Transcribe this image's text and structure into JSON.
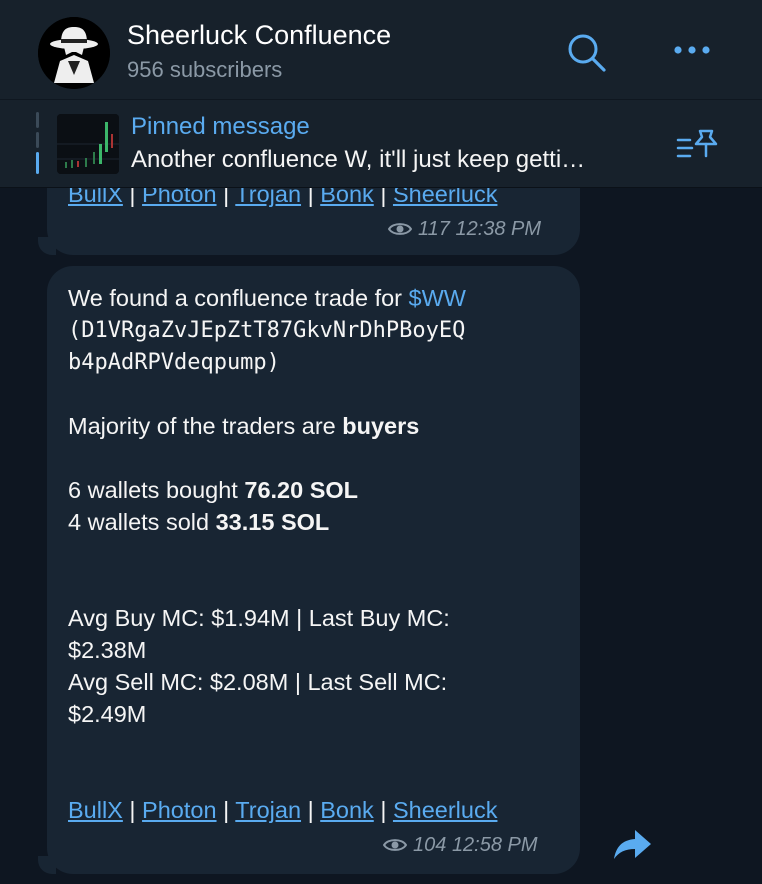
{
  "header": {
    "title": "Sheerluck Confluence",
    "subscribers": "956 subscribers"
  },
  "pinned": {
    "label": "Pinned message",
    "text": "Another confluence W, it'll just keep getti…"
  },
  "prev_message": {
    "links": [
      "BullX",
      "Photon",
      "Trojan",
      "Bonk",
      "Sheerluck"
    ],
    "views": "117",
    "time": "12:38 PM"
  },
  "message": {
    "intro": "We found a confluence trade for ",
    "ticker": "$WW",
    "address_line1": "(D1VRgaZvJEpZtT87GkvNrDhPBoyEQ",
    "address_line2": "b4pAdRPVdeqpump)",
    "majority_prefix": "Majority of the traders are ",
    "majority_bold": "buyers",
    "bought_prefix": "6 wallets bought ",
    "bought_bold": "76.20 SOL",
    "sold_prefix": "4 wallets sold ",
    "sold_bold": "33.15 SOL",
    "avg_buy_line1": "Avg Buy MC: $1.94M | Last Buy MC:",
    "avg_buy_line2": "$2.38M",
    "avg_sell_line1": "Avg Sell MC: $2.08M | Last Sell MC:",
    "avg_sell_line2": "$2.49M",
    "links": [
      "BullX",
      "Photon",
      "Trojan",
      "Bonk",
      "Sheerluck"
    ],
    "separator": "|",
    "views": "104",
    "time": "12:58 PM"
  },
  "colors": {
    "background": "#0e1621",
    "bubble": "#182533",
    "accent": "#5aabf0",
    "header": "#17212b",
    "muted": "#8b99a6"
  },
  "icons": [
    "search-icon",
    "more-icon",
    "pin-list-icon",
    "eye-icon",
    "forward-icon"
  ]
}
